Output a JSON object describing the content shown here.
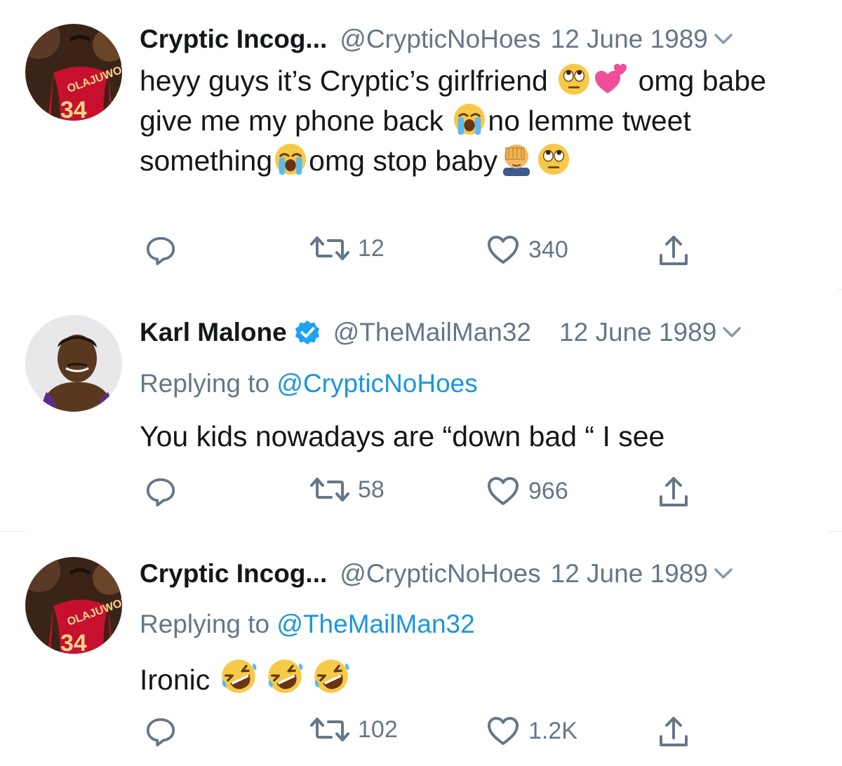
{
  "colors": {
    "name": "#14171a",
    "secondary": "#657786",
    "link": "#1b95e0",
    "divider": "#e1e8ed"
  },
  "tweets": [
    {
      "author_name": "Cryptic Incog...",
      "handle": "@CrypticNoHoes",
      "date": "12 June 1989",
      "verified": false,
      "avatar": "rockets-player-34-avatar",
      "text_parts": [
        "heyy guys it’s Cryptic’s girlfriend ",
        " omg babe give me my phone back ",
        "no lemme tweet something",
        "omg stop baby",
        ""
      ],
      "emojis": [
        "eye-roll-emoji",
        "two-hearts-emoji",
        "crying-emoji",
        "crying-emoji",
        "facepalm-emoji",
        "eye-roll-emoji"
      ],
      "reply_count": "",
      "retweet_count": "12",
      "like_count": "340"
    },
    {
      "author_name": "Karl Malone",
      "handle": "@TheMailMan32",
      "date": "12 June 1989",
      "verified": true,
      "avatar": "jazz-player-avatar",
      "replying_prefix": "Replying to ",
      "replying_to": "@CrypticNoHoes",
      "text": "You kids nowadays are “down bad “ I see",
      "reply_count": "",
      "retweet_count": "58",
      "like_count": "966"
    },
    {
      "author_name": "Cryptic Incog...",
      "handle": "@CrypticNoHoes",
      "date": "12 June 1989",
      "verified": false,
      "avatar": "rockets-player-34-avatar",
      "replying_prefix": "Replying to ",
      "replying_to": "@TheMailMan32",
      "text": "Ironic ",
      "emojis": [
        "rofl-emoji",
        "rofl-emoji",
        "rofl-emoji"
      ],
      "reply_count": "",
      "retweet_count": "102",
      "like_count": "1.2K"
    }
  ],
  "icons": {
    "reply": "reply-icon",
    "retweet": "retweet-icon",
    "like": "heart-icon",
    "share": "share-icon",
    "caret": "chevron-down-icon",
    "verified": "verified-badge-icon"
  }
}
